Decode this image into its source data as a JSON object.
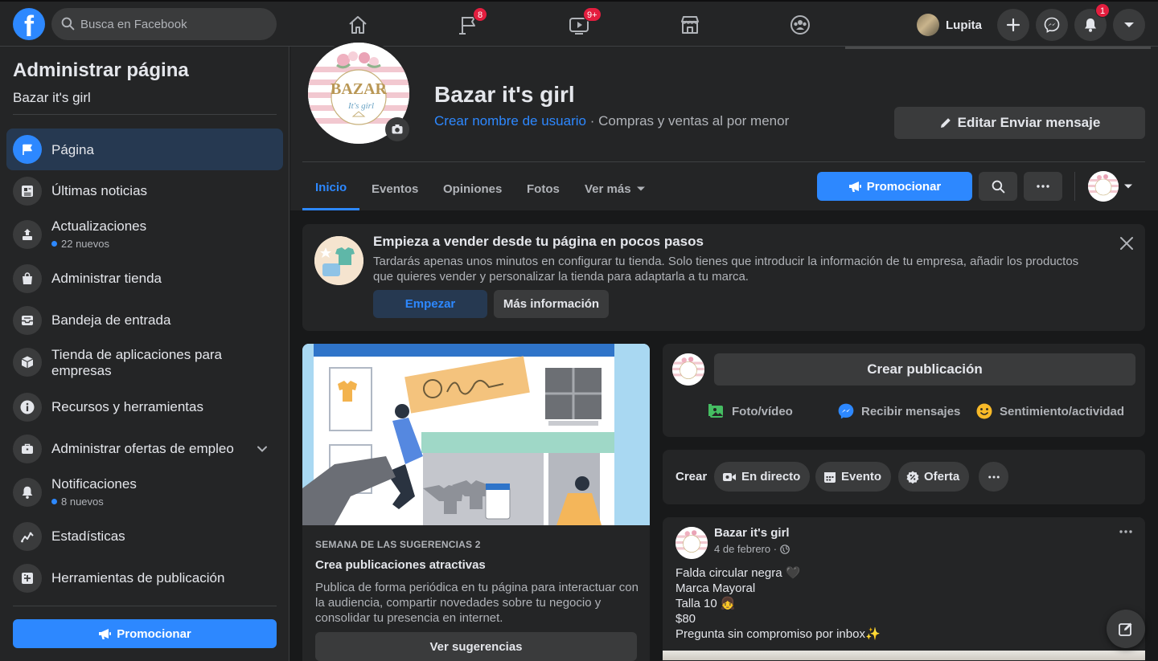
{
  "topbar": {
    "logo": "f",
    "search_placeholder": "Busca en Facebook",
    "nav": [
      {
        "icon": "home-icon"
      },
      {
        "icon": "flag-icon",
        "badge": "8"
      },
      {
        "icon": "watch-icon",
        "badge": "9+"
      },
      {
        "icon": "marketplace-icon"
      },
      {
        "icon": "groups-icon"
      }
    ],
    "user_name": "Lupita",
    "notifications_badge": "1"
  },
  "sidebar": {
    "title": "Administrar página",
    "page_name": "Bazar it's girl",
    "items": [
      {
        "label": "Página",
        "icon": "flag-icon"
      },
      {
        "label": "Últimas noticias",
        "icon": "news-feed-icon"
      },
      {
        "label": "Actualizaciones",
        "icon": "updates-icon",
        "note": "22 nuevos"
      },
      {
        "label": "Administrar tienda",
        "icon": "shopping-bag-icon"
      },
      {
        "label": "Bandeja de entrada",
        "icon": "inbox-icon"
      },
      {
        "label": "Tienda de aplicaciones para empresas",
        "icon": "box-icon"
      },
      {
        "label": "Recursos y herramientas",
        "icon": "info-icon"
      },
      {
        "label": "Administrar ofertas de empleo",
        "icon": "briefcase-icon"
      },
      {
        "label": "Notificaciones",
        "icon": "bell-icon",
        "note": "8 nuevos"
      },
      {
        "label": "Estadísticas",
        "icon": "insights-icon"
      },
      {
        "label": "Herramientas de publicación",
        "icon": "publishing-tools-icon"
      }
    ],
    "promote_label": "Promocionar"
  },
  "page_header": {
    "avatar_text_1": "BAZAR",
    "avatar_text_2": "It's girl",
    "name": "Bazar it's girl",
    "username_link": "Crear nombre de usuario",
    "category": " · Compras y ventas al por menor",
    "edit_button": "Editar Enviar mensaje",
    "tabs": [
      "Inicio",
      "Eventos",
      "Opiniones",
      "Fotos",
      "Ver más"
    ],
    "promote_label": "Promocionar"
  },
  "shop_card": {
    "title": "Empieza a vender desde tu página en pocos pasos",
    "description": "Tardarás apenas unos minutos en configurar tu tienda. Solo tienes que introducir la información de tu empresa, añadir los productos que quieres vender y personalizar la tienda para adaptarla a tu marca.",
    "start_button": "Empezar",
    "info_button": "Más información"
  },
  "tip_card": {
    "kicker": "SEMANA DE LAS SUGERENCIAS 2",
    "title": "Crea publicaciones atractivas",
    "description": "Publica de forma periódica en tu página para interactuar con la audiencia, compartir novedades sobre tu negocio y consolidar tu presencia en internet.",
    "button": "Ver sugerencias"
  },
  "composer": {
    "placeholder": "Crear publicación",
    "actions": [
      "Foto/vídeo",
      "Recibir mensajes",
      "Sentimiento/actividad"
    ]
  },
  "create_bar": {
    "label": "Crear",
    "pills": [
      "En directo",
      "Evento",
      "Oferta"
    ]
  },
  "post": {
    "author": "Bazar it's girl",
    "date": "4 de febrero · ",
    "lines": [
      "Falda circular negra 🖤",
      "Marca Mayoral",
      "Talla 10 👧",
      "$80",
      "Pregunta sin compromiso por inbox✨"
    ]
  },
  "colors": {
    "accent": "#2d88ff",
    "background": "#18191a",
    "surface": "#242526",
    "button": "#3a3b3c",
    "badge": "#e41e3f"
  }
}
